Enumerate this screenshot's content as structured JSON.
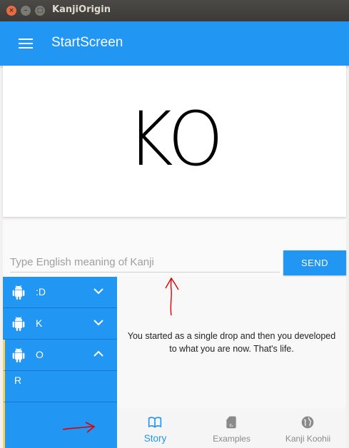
{
  "window": {
    "title": "KanjiOrigin",
    "close_glyph": "×",
    "min_glyph": "–",
    "max_glyph": "□"
  },
  "appbar": {
    "title": "StartScreen",
    "menu_icon": "hamburger-menu-icon"
  },
  "kanji": {
    "display": "KO"
  },
  "input": {
    "placeholder": "Type English meaning of Kanji",
    "value": ""
  },
  "send_button": {
    "label": "SEND"
  },
  "sidebar": {
    "items": [
      {
        "label": ":D",
        "icon": "android-icon",
        "chevron": "down"
      },
      {
        "label": "K",
        "icon": "android-icon",
        "chevron": "down"
      },
      {
        "label": "O",
        "icon": "android-icon",
        "chevron": "up"
      }
    ],
    "sub_items": [
      {
        "label": "R"
      }
    ]
  },
  "story": {
    "text": "You started as a single drop   and then you developed\nto what you are now. That's life."
  },
  "bottom_nav": {
    "tabs": [
      {
        "label": "Story",
        "icon": "book-icon",
        "active": true
      },
      {
        "label": "Examples",
        "icon": "sd-card-icon",
        "active": false
      },
      {
        "label": "Kanji Koohii",
        "icon": "globe-icon",
        "active": false
      }
    ]
  },
  "colors": {
    "primary": "#2196f3",
    "accent_border": "#ffd54f",
    "annotation": "#e00000"
  }
}
